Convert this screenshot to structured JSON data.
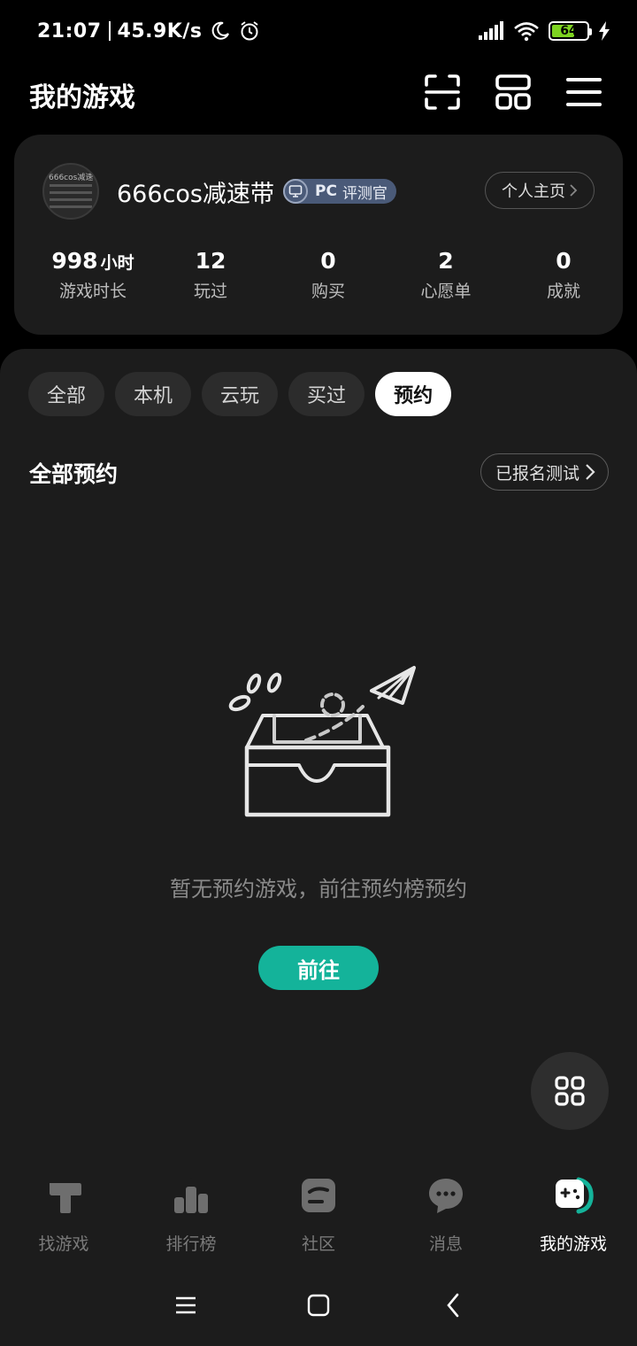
{
  "status_bar": {
    "time": "21:07",
    "speed": "45.9K/s",
    "battery": "64",
    "icons": [
      "moon-icon",
      "alarm-icon",
      "signal-icon",
      "wifi-icon",
      "battery-icon",
      "charging-icon"
    ]
  },
  "header": {
    "title": "我的游戏",
    "icons": [
      "scan-icon",
      "grid-layout-icon",
      "menu-icon"
    ]
  },
  "profile": {
    "avatar_text": "666cos减速带",
    "username": "666cos减速带",
    "badge_prefix": "PC",
    "badge_label": "评测官",
    "homepage_button": "个人主页",
    "stats": [
      {
        "value": "998",
        "unit": "小时",
        "label": "游戏时长"
      },
      {
        "value": "12",
        "unit": "",
        "label": "玩过"
      },
      {
        "value": "0",
        "unit": "",
        "label": "购买"
      },
      {
        "value": "2",
        "unit": "",
        "label": "心愿单"
      },
      {
        "value": "0",
        "unit": "",
        "label": "成就"
      }
    ]
  },
  "tabs": [
    {
      "label": "全部",
      "active": false
    },
    {
      "label": "本机",
      "active": false
    },
    {
      "label": "云玩",
      "active": false
    },
    {
      "label": "买过",
      "active": false
    },
    {
      "label": "预约",
      "active": true
    }
  ],
  "section": {
    "title": "全部预约",
    "signed_button": "已报名测试"
  },
  "empty_state": {
    "message": "暂无预约游戏，前往预约榜预约",
    "button": "前往"
  },
  "colors": {
    "accent": "#14b39a",
    "badge_bg": "#4a5a78",
    "panel_bg": "#1c1c1c"
  },
  "bottom_nav": [
    {
      "label": "找游戏",
      "icon": "find-game-icon",
      "active": false
    },
    {
      "label": "排行榜",
      "icon": "ranking-icon",
      "active": false
    },
    {
      "label": "社区",
      "icon": "community-icon",
      "active": false
    },
    {
      "label": "消息",
      "icon": "message-icon",
      "active": false
    },
    {
      "label": "我的游戏",
      "icon": "my-games-icon",
      "active": true
    }
  ]
}
